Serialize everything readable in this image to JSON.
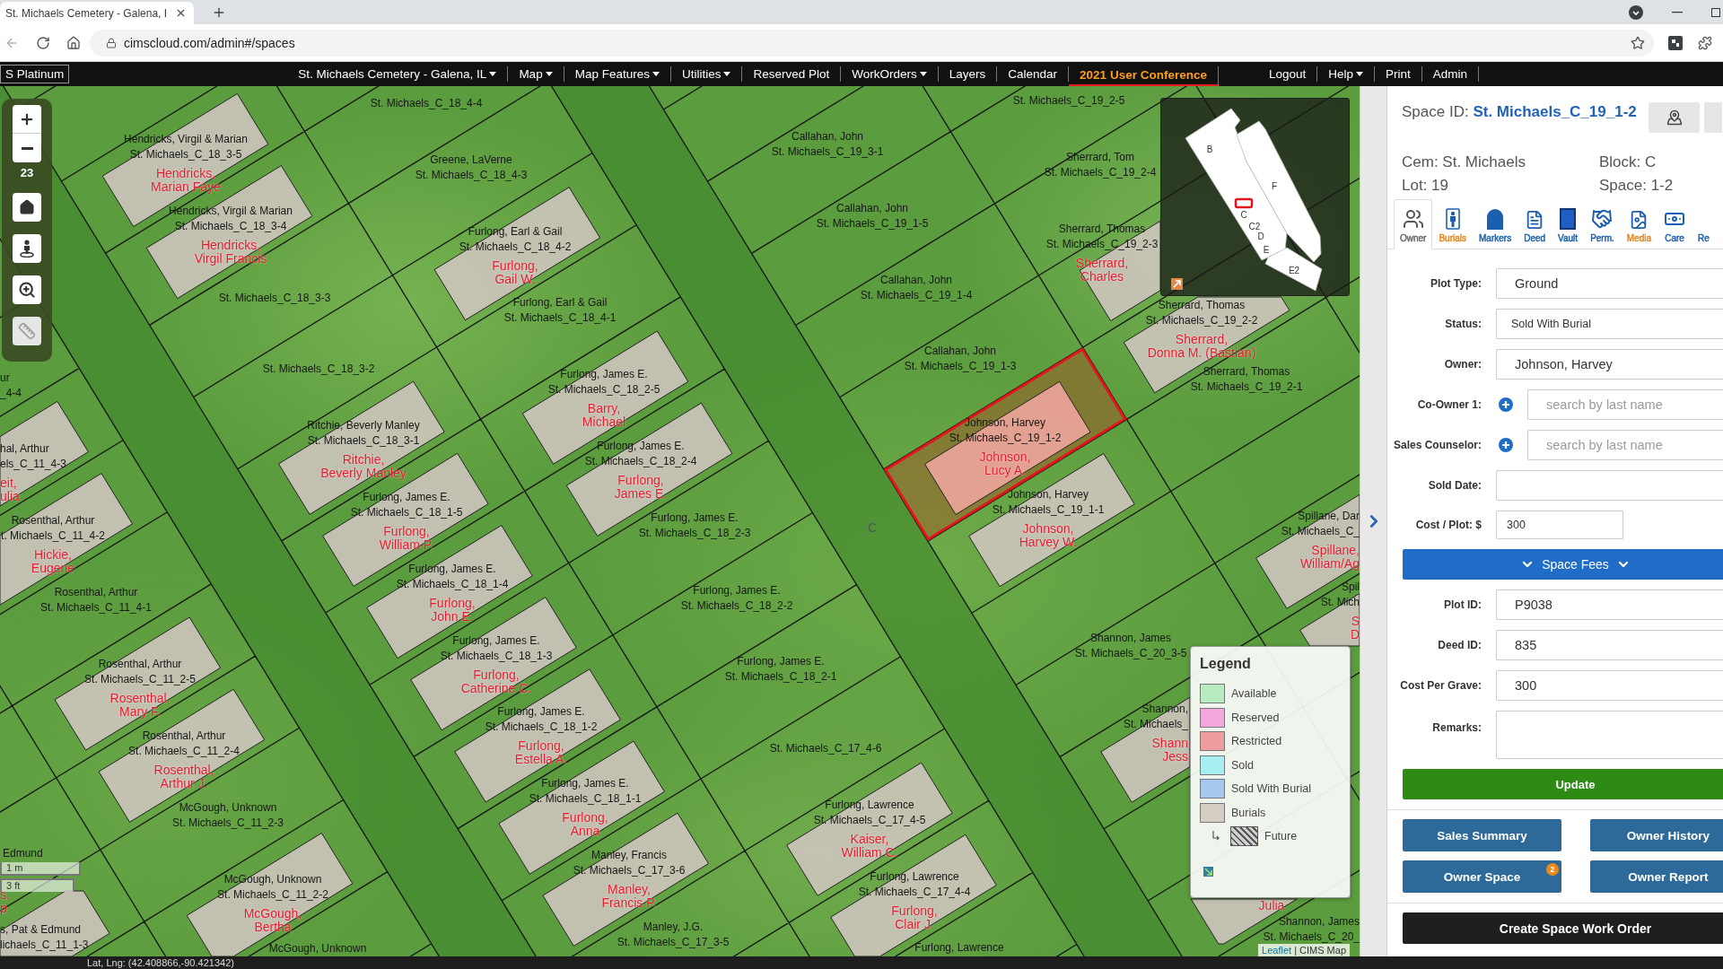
{
  "browser": {
    "tab_title": "St. Michaels Cemetery - Galena, I",
    "url": "cimscloud.com/admin#/spaces"
  },
  "navbar": {
    "brand": "S Platinum",
    "items": [
      {
        "label": "St. Michaels Cemetery - Galena, IL",
        "dropdown": true,
        "featured": false
      },
      {
        "label": "Map",
        "dropdown": true,
        "featured": false
      },
      {
        "label": "Map Features",
        "dropdown": true,
        "featured": false
      },
      {
        "label": "Utilities",
        "dropdown": true,
        "featured": false
      },
      {
        "label": "Reserved Plot",
        "dropdown": false,
        "featured": false
      },
      {
        "label": "WorkOrders",
        "dropdown": true,
        "featured": false
      },
      {
        "label": "Layers",
        "dropdown": false,
        "featured": false
      },
      {
        "label": "Calendar",
        "dropdown": false,
        "featured": false
      },
      {
        "label": "2021 User Conference",
        "dropdown": false,
        "featured": true
      }
    ],
    "right_items": [
      {
        "label": "Logout",
        "dropdown": false
      },
      {
        "label": "Help",
        "dropdown": true
      },
      {
        "label": "Print",
        "dropdown": false
      },
      {
        "label": "Admin",
        "dropdown": false
      }
    ]
  },
  "map": {
    "zoom_level": "23",
    "scale": [
      "1 m",
      "3 ft"
    ],
    "block_label": "C",
    "plots": [
      {
        "owner": "Hendricks, Virgil & Marian",
        "space": "St. Michaels_C_18_3-5",
        "burial": "Hendricks,\nMarian Faye",
        "selected": false
      },
      {
        "space": "St. Michaels_C_18_4-4",
        "selected": false
      },
      {
        "owner": "Hendricks, Virgil & Marian",
        "space": "St. Michaels_C_18_3-4",
        "burial": "Hendricks,\nVirgil Francis",
        "selected": false
      },
      {
        "owner": "Greene, LaVerne",
        "space": "St. Michaels_C_18_4-3",
        "selected": false
      },
      {
        "space": "St. Michaels_C_18_3-3",
        "selected": false
      },
      {
        "owner": "Furlong, Earl & Gail",
        "space": "St. Michaels_C_18_4-2",
        "burial": "Furlong,\nGail W.",
        "selected": false
      },
      {
        "owner": "Furlong, Earl & Gail",
        "space": "St. Michaels_C_18_4-1",
        "selected": false
      },
      {
        "space": "St. Michaels_C_18_3-2",
        "selected": false
      },
      {
        "owner": "Furlong, James E.",
        "space": "St. Michaels_C_18_2-5",
        "burial": "Barry,\nMichael",
        "selected": false
      },
      {
        "owner": "Ritchie, Beverly Manley",
        "space": "St. Michaels_C_18_3-1",
        "burial": "Ritchie,\nBeverly Manley",
        "selected": false
      },
      {
        "owner": "Furlong, James E.",
        "space": "St. Michaels_C_18_2-4",
        "burial": "Furlong,\nJames E.",
        "selected": false
      },
      {
        "owner": "Furlong, James E.",
        "space": "St. Michaels_C_18_1-5",
        "burial": "Furlong,\nWilliam P.",
        "selected": false
      },
      {
        "owner": "Furlong, James E.",
        "space": "St. Michaels_C_18_2-3",
        "selected": false
      },
      {
        "owner": "Furlong, James E.",
        "space": "St. Michaels_C_18_1-4",
        "burial": "Furlong,\nJohn E.",
        "selected": false
      },
      {
        "owner": "Furlong, James E.",
        "space": "St. Michaels_C_18_2-2",
        "selected": false
      },
      {
        "owner": "Furlong, James E.",
        "space": "St. Michaels_C_18_1-3",
        "burial": "Furlong,\nCatherine C.",
        "selected": false
      },
      {
        "owner": "Furlong, James E.",
        "space": "St. Michaels_C_18_2-1",
        "selected": false
      },
      {
        "owner": "Furlong, James E.",
        "space": "St. Michaels_C_18_1-2",
        "burial": "Furlong,\nEstella A.",
        "selected": false
      },
      {
        "space": "St. Michaels_C_17_4-6",
        "selected": false
      },
      {
        "owner": "Furlong, James E.",
        "space": "St. Michaels_C_18_1-1",
        "burial": "Furlong,\nAnna",
        "selected": false
      },
      {
        "owner": "Furlong, Lawrence",
        "space": "St. Michaels_C_17_4-5",
        "burial": "Kaiser,\nWilliam C.",
        "selected": false
      },
      {
        "owner": "Manley, Francis",
        "space": "St. Michaels_C_17_3-6",
        "burial": "Manley,\nFrancis P.",
        "selected": false
      },
      {
        "owner": "Furlong, Lawrence",
        "space": "St. Michaels_C_17_4-4",
        "burial": "Furlong,\nClair J.",
        "selected": false
      },
      {
        "owner": "Manley, J.G.",
        "space": "St. Michaels_C_17_3-5",
        "selected": false
      },
      {
        "owner": "Furlong, Lawrence",
        "selected": false
      },
      {
        "owner": "ur",
        "space": "_4-4",
        "selected": false
      },
      {
        "owner": "hal, Arthur",
        "space": "els_C_11_4-3",
        "burial": "eit,\nulia",
        "selected": false
      },
      {
        "owner": "Rosenthal, Arthur",
        "space": "t. Michaels_C_11_4-2",
        "burial": "Hickie,\nEugene",
        "selected": false
      },
      {
        "owner": "Rosenthal, Arthur",
        "space": "St. Michaels_C_11_4-1",
        "selected": false
      },
      {
        "owner": "Rosenthal, Arthur",
        "space": "St. Michaels_C_11_2-5",
        "burial": "Rosenthal,\nMary F.",
        "selected": false
      },
      {
        "owner": "Rosenthal, Arthur",
        "space": "St. Michaels_C_11_2-4",
        "burial": "Rosenthal,\nArthur J.",
        "selected": false
      },
      {
        "owner": "McGough, Unknown",
        "space": "St. Michaels_C_11_2-3",
        "selected": false
      },
      {
        "owner": "Edmund",
        "selected": false
      },
      {
        "burial": "s,\np",
        "selected": false
      },
      {
        "owner": "s, Pat & Edmund",
        "space": "lichaels_C_11_1-3",
        "selected": false
      },
      {
        "owner": "McGough, Unknown",
        "space": "St. Michaels_C_11_2-2",
        "burial": "McGough,\nBertha",
        "selected": false
      },
      {
        "owner": "McGough, Unknown",
        "selected": false
      },
      {
        "space": "St. Michaels_C_19_2-5",
        "selected": false
      },
      {
        "owner": "Callahan, John",
        "space": "St. Michaels_C_19_3-1",
        "selected": false
      },
      {
        "owner": "Sherrard, Tom",
        "space": "St. Michaels_C_19_2-4",
        "selected": false
      },
      {
        "owner": "Callahan, John",
        "space": "St. Michaels_C_19_1-5",
        "selected": false
      },
      {
        "owner": "Sherrard, Thomas",
        "space": "St. Michaels_C_19_2-3",
        "burial": "Sherrard,\nCharles",
        "selected": false
      },
      {
        "owner": "Callahan, John",
        "space": "St. Michaels_C_19_1-4",
        "selected": false
      },
      {
        "owner": "Sherrard, Thomas",
        "space": "St. Michaels_C_19_2-2",
        "burial": "Sherrard,\nDonna M. (Bastian)",
        "selected": false
      },
      {
        "owner": "Callahan, John",
        "space": "St. Michaels_C_19_1-3",
        "selected": false
      },
      {
        "owner": "Sherrard, Thomas",
        "space": "St. Michaels_C_19_2-1",
        "selected": false
      },
      {
        "owner": "Johnson, Harvey",
        "space": "St. Michaels_C_19_1-2",
        "burial": "Johnson,\nLucy A.",
        "selected": true
      },
      {
        "owner": "Johnson, Harvey",
        "space": "St. Michaels_C_19_1-1",
        "burial": "Johnson,\nHarvey W.",
        "selected": false
      },
      {
        "owner": "Spillane, Dar",
        "space": "St. Michaels_C_",
        "burial": "Spillane,\nWilliam/Ag",
        "selected": false
      },
      {
        "owner": "Spil",
        "space": "St. Mich",
        "burial": "S\nD",
        "selected": false
      },
      {
        "owner": "Shannon, James",
        "space": "St. Michaels_C_20_3-5",
        "selected": false
      },
      {
        "owner": "Shannon,",
        "space": "St. Michaels_",
        "burial": "Shann\nJess",
        "selected": false
      },
      {
        "burial": "Julia",
        "selected": false
      },
      {
        "owner": "Shannon, James",
        "space": "St. Michaels_C_20_",
        "selected": false
      }
    ],
    "minimap": {
      "sections": [
        "B",
        "F",
        "C",
        "C2",
        "D",
        "E",
        "E2"
      ]
    },
    "legend": {
      "title": "Legend",
      "items": [
        {
          "label": "Available",
          "kind": "swatch",
          "color": "#b8ecc0"
        },
        {
          "label": "Reserved",
          "kind": "swatch",
          "color": "#f2a8dc"
        },
        {
          "label": "Restricted",
          "kind": "swatch",
          "color": "#ee9e9e"
        },
        {
          "label": "Sold",
          "kind": "swatch",
          "color": "#a8eef0"
        },
        {
          "label": "Sold With Burial",
          "kind": "swatch",
          "color": "#a4c8ee"
        },
        {
          "label": "Burials",
          "kind": "swatch",
          "color": "#d6cdc4",
          "children": [
            {
              "label": "Future",
              "kind": "hatched"
            }
          ]
        }
      ]
    },
    "attribution": {
      "link": "Leaflet",
      "text": "| CIMS Map"
    }
  },
  "panel": {
    "space_id_label": "Space ID:",
    "space_id": "St. Michaels_C_19_1-2",
    "info": [
      "Cem: St. Michaels",
      "Block: C",
      "Lot: 19",
      "Space: 1-2"
    ],
    "tabs": [
      {
        "label": "Owner",
        "selected": true,
        "color": "#666666"
      },
      {
        "label": "Burials",
        "selected": false,
        "color": "#e0861a"
      },
      {
        "label": "Markers",
        "selected": false,
        "color": "#1b5fae"
      },
      {
        "label": "Deed",
        "selected": false,
        "color": "#1b5fae"
      },
      {
        "label": "Vault",
        "selected": false,
        "color": "#1b5fae"
      },
      {
        "label": "Perm.",
        "selected": false,
        "color": "#1b5fae"
      },
      {
        "label": "Media",
        "selected": false,
        "color": "#e0861a"
      },
      {
        "label": "Care",
        "selected": false,
        "color": "#1b5fae"
      },
      {
        "label": "Re",
        "selected": false,
        "color": "#1b5fae"
      }
    ],
    "fields": [
      {
        "label": "Plot Type:",
        "value": "Ground",
        "kind": "text"
      },
      {
        "label": "Status:",
        "value": "Sold With Burial",
        "kind": "select"
      },
      {
        "label": "Owner:",
        "value": "Johnson, Harvey",
        "kind": "text"
      },
      {
        "label": "Co-Owner 1:",
        "placeholder": "search by last name",
        "kind": "search"
      },
      {
        "label": "Sales Counselor:",
        "placeholder": "search by last name",
        "kind": "search"
      },
      {
        "label": "Sold Date:",
        "kind": "text"
      },
      {
        "label": "Cost / Plot: $",
        "value": "300",
        "kind": "short"
      }
    ],
    "space_fees": {
      "label": "Space Fees",
      "expanded": false
    },
    "more_fields": [
      {
        "label": "Plot ID:",
        "value": "P9038",
        "kind": "text"
      },
      {
        "label": "Deed ID:",
        "value": "835",
        "kind": "text"
      },
      {
        "label": "Cost Per Grave:",
        "value": "300",
        "kind": "text"
      },
      {
        "label": "Remarks:",
        "kind": "textarea"
      }
    ],
    "update_button": "Update",
    "buttons": [
      {
        "label": "Sales Summary"
      },
      {
        "label": "Owner History"
      },
      {
        "label": "Owner Space",
        "badge": "2"
      },
      {
        "label": "Owner Report"
      }
    ],
    "work_order_button": "Create Space Work Order"
  },
  "status_bar": {
    "coordinates": "Lat, Lng: (42.408866,-90.421342)"
  }
}
